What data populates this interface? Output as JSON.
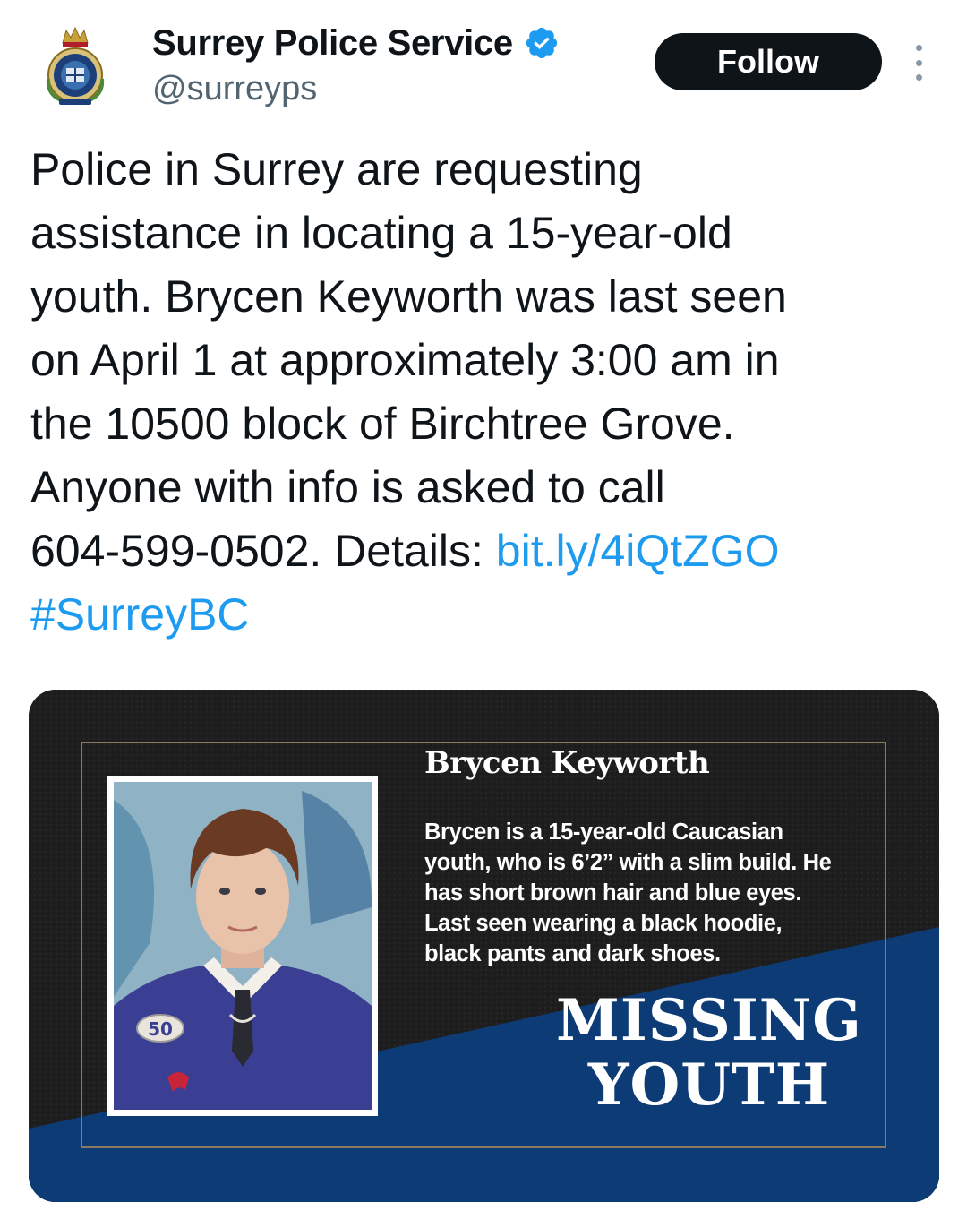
{
  "tweet": {
    "author_name": "Surrey Police Service",
    "handle": "@surreyps",
    "follow_label": "Follow",
    "text_lines": [
      "Police in Surrey are requesting",
      "assistance in locating a 15-year-old",
      "youth. Brycen Keyworth was last seen",
      "on April 1 at approximately 3:00 am in",
      "the 10500 block of Birchtree Grove.",
      "Anyone with info is asked to call"
    ],
    "text_line7_prefix": "604-599-0502. Details: ",
    "link": "bit.ly/4iQtZGO",
    "hashtag": "#SurreyBC"
  },
  "poster": {
    "name": "Brycen Keyworth",
    "description_lines": [
      "Brycen is a 15-year-old Caucasian",
      "youth, who is 6’2” with a slim build. He",
      "has short brown hair and blue eyes.",
      "Last seen wearing a black hoodie,",
      "black pants and dark shoes."
    ],
    "headline_lines": [
      "MISSING",
      "YOUTH"
    ],
    "jersey_number": "50"
  },
  "colors": {
    "link_blue": "#1d9bf0",
    "verified_blue": "#1d9bf0",
    "poster_navy": "#0d3b75",
    "poster_dark": "#1e1e1f"
  },
  "icons": {
    "avatar": "surrey-police-crest-icon",
    "verified": "verified-badge-icon",
    "more": "more-options-icon"
  }
}
